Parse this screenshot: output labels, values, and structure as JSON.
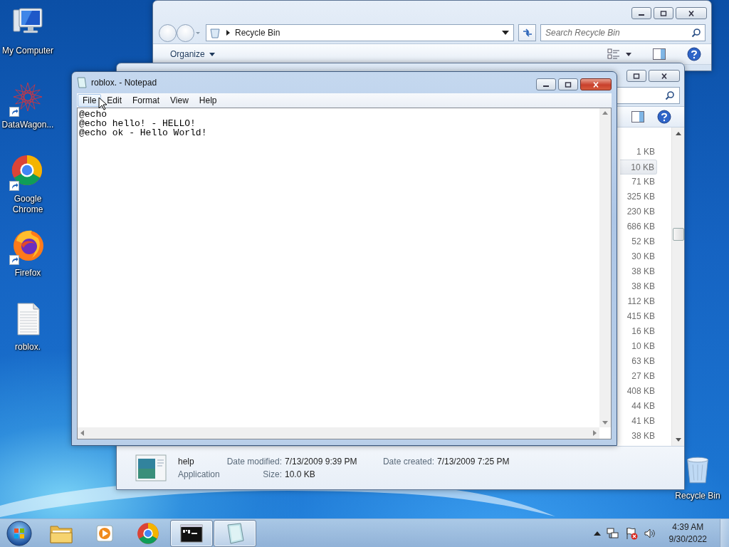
{
  "desktop": {
    "icons": [
      {
        "kind": "computer",
        "label": "My Computer",
        "shortcut": false
      },
      {
        "kind": "network",
        "label": "DataWagon...",
        "shortcut": true
      },
      {
        "kind": "chrome",
        "label": "Google Chrome",
        "shortcut": true
      },
      {
        "kind": "firefox",
        "label": "Firefox",
        "shortcut": true
      },
      {
        "kind": "file",
        "label": "roblox.",
        "shortcut": false
      }
    ],
    "recycle_bin": {
      "label": "Recycle Bin"
    }
  },
  "explorer_back": {
    "address": "Recycle Bin",
    "search": {
      "placeholder": "Search Recycle Bin"
    },
    "toolbar": {
      "organize": "Organize"
    }
  },
  "explorer_front": {
    "sizes": [
      {
        "text": "1 KB",
        "selected": false
      },
      {
        "text": "10 KB",
        "selected": true
      },
      {
        "text": "71 KB",
        "selected": false
      },
      {
        "text": "325 KB",
        "selected": false
      },
      {
        "text": "230 KB",
        "selected": false
      },
      {
        "text": "686 KB",
        "selected": false
      },
      {
        "text": "52 KB",
        "selected": false
      },
      {
        "text": "30 KB",
        "selected": false
      },
      {
        "text": "38 KB",
        "selected": false
      },
      {
        "text": "38 KB",
        "selected": false
      },
      {
        "text": "112 KB",
        "selected": false
      },
      {
        "text": "415 KB",
        "selected": false
      },
      {
        "text": "16 KB",
        "selected": false
      },
      {
        "text": "10 KB",
        "selected": false
      },
      {
        "text": "63 KB",
        "selected": false
      },
      {
        "text": "27 KB",
        "selected": false
      },
      {
        "text": "408 KB",
        "selected": false
      },
      {
        "text": "44 KB",
        "selected": false
      },
      {
        "text": "41 KB",
        "selected": false
      },
      {
        "text": "38 KB",
        "selected": false
      }
    ],
    "details": {
      "name": "help",
      "type": "Application",
      "date_modified_label": "Date modified:",
      "date_modified": "7/13/2009 9:39 PM",
      "size_label": "Size:",
      "size": "10.0 KB",
      "date_created_label": "Date created:",
      "date_created": "7/13/2009 7:25 PM"
    }
  },
  "notepad": {
    "title": "roblox. - Notepad",
    "menu": [
      {
        "label": "File",
        "selected": true
      },
      {
        "label": "Edit",
        "selected": false
      },
      {
        "label": "Format",
        "selected": false
      },
      {
        "label": "View",
        "selected": false
      },
      {
        "label": "Help",
        "selected": false
      }
    ],
    "lines": [
      "@echo",
      "@echo hello! - HELLO!",
      "@echo ok - Hello World!"
    ]
  },
  "taskbar": {
    "items": [
      {
        "kind": "folder",
        "running": false
      },
      {
        "kind": "media",
        "running": false
      },
      {
        "kind": "chrome",
        "running": false
      },
      {
        "kind": "cmd",
        "running": true
      },
      {
        "kind": "notepad",
        "running": true
      }
    ],
    "clock": {
      "time": "4:39 AM",
      "date": "9/30/2022"
    }
  }
}
